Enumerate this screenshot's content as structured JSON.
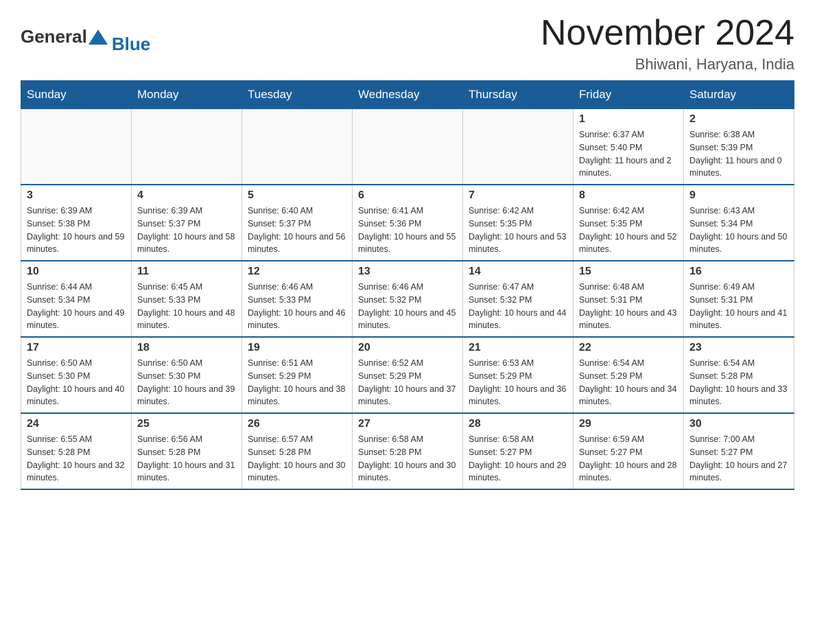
{
  "header": {
    "logo_text_general": "General",
    "logo_text_blue": "Blue",
    "calendar_title": "November 2024",
    "calendar_subtitle": "Bhiwani, Haryana, India"
  },
  "weekdays": [
    "Sunday",
    "Monday",
    "Tuesday",
    "Wednesday",
    "Thursday",
    "Friday",
    "Saturday"
  ],
  "weeks": [
    [
      {
        "day": "",
        "info": ""
      },
      {
        "day": "",
        "info": ""
      },
      {
        "day": "",
        "info": ""
      },
      {
        "day": "",
        "info": ""
      },
      {
        "day": "",
        "info": ""
      },
      {
        "day": "1",
        "info": "Sunrise: 6:37 AM\nSunset: 5:40 PM\nDaylight: 11 hours and 2 minutes."
      },
      {
        "day": "2",
        "info": "Sunrise: 6:38 AM\nSunset: 5:39 PM\nDaylight: 11 hours and 0 minutes."
      }
    ],
    [
      {
        "day": "3",
        "info": "Sunrise: 6:39 AM\nSunset: 5:38 PM\nDaylight: 10 hours and 59 minutes."
      },
      {
        "day": "4",
        "info": "Sunrise: 6:39 AM\nSunset: 5:37 PM\nDaylight: 10 hours and 58 minutes."
      },
      {
        "day": "5",
        "info": "Sunrise: 6:40 AM\nSunset: 5:37 PM\nDaylight: 10 hours and 56 minutes."
      },
      {
        "day": "6",
        "info": "Sunrise: 6:41 AM\nSunset: 5:36 PM\nDaylight: 10 hours and 55 minutes."
      },
      {
        "day": "7",
        "info": "Sunrise: 6:42 AM\nSunset: 5:35 PM\nDaylight: 10 hours and 53 minutes."
      },
      {
        "day": "8",
        "info": "Sunrise: 6:42 AM\nSunset: 5:35 PM\nDaylight: 10 hours and 52 minutes."
      },
      {
        "day": "9",
        "info": "Sunrise: 6:43 AM\nSunset: 5:34 PM\nDaylight: 10 hours and 50 minutes."
      }
    ],
    [
      {
        "day": "10",
        "info": "Sunrise: 6:44 AM\nSunset: 5:34 PM\nDaylight: 10 hours and 49 minutes."
      },
      {
        "day": "11",
        "info": "Sunrise: 6:45 AM\nSunset: 5:33 PM\nDaylight: 10 hours and 48 minutes."
      },
      {
        "day": "12",
        "info": "Sunrise: 6:46 AM\nSunset: 5:33 PM\nDaylight: 10 hours and 46 minutes."
      },
      {
        "day": "13",
        "info": "Sunrise: 6:46 AM\nSunset: 5:32 PM\nDaylight: 10 hours and 45 minutes."
      },
      {
        "day": "14",
        "info": "Sunrise: 6:47 AM\nSunset: 5:32 PM\nDaylight: 10 hours and 44 minutes."
      },
      {
        "day": "15",
        "info": "Sunrise: 6:48 AM\nSunset: 5:31 PM\nDaylight: 10 hours and 43 minutes."
      },
      {
        "day": "16",
        "info": "Sunrise: 6:49 AM\nSunset: 5:31 PM\nDaylight: 10 hours and 41 minutes."
      }
    ],
    [
      {
        "day": "17",
        "info": "Sunrise: 6:50 AM\nSunset: 5:30 PM\nDaylight: 10 hours and 40 minutes."
      },
      {
        "day": "18",
        "info": "Sunrise: 6:50 AM\nSunset: 5:30 PM\nDaylight: 10 hours and 39 minutes."
      },
      {
        "day": "19",
        "info": "Sunrise: 6:51 AM\nSunset: 5:29 PM\nDaylight: 10 hours and 38 minutes."
      },
      {
        "day": "20",
        "info": "Sunrise: 6:52 AM\nSunset: 5:29 PM\nDaylight: 10 hours and 37 minutes."
      },
      {
        "day": "21",
        "info": "Sunrise: 6:53 AM\nSunset: 5:29 PM\nDaylight: 10 hours and 36 minutes."
      },
      {
        "day": "22",
        "info": "Sunrise: 6:54 AM\nSunset: 5:29 PM\nDaylight: 10 hours and 34 minutes."
      },
      {
        "day": "23",
        "info": "Sunrise: 6:54 AM\nSunset: 5:28 PM\nDaylight: 10 hours and 33 minutes."
      }
    ],
    [
      {
        "day": "24",
        "info": "Sunrise: 6:55 AM\nSunset: 5:28 PM\nDaylight: 10 hours and 32 minutes."
      },
      {
        "day": "25",
        "info": "Sunrise: 6:56 AM\nSunset: 5:28 PM\nDaylight: 10 hours and 31 minutes."
      },
      {
        "day": "26",
        "info": "Sunrise: 6:57 AM\nSunset: 5:28 PM\nDaylight: 10 hours and 30 minutes."
      },
      {
        "day": "27",
        "info": "Sunrise: 6:58 AM\nSunset: 5:28 PM\nDaylight: 10 hours and 30 minutes."
      },
      {
        "day": "28",
        "info": "Sunrise: 6:58 AM\nSunset: 5:27 PM\nDaylight: 10 hours and 29 minutes."
      },
      {
        "day": "29",
        "info": "Sunrise: 6:59 AM\nSunset: 5:27 PM\nDaylight: 10 hours and 28 minutes."
      },
      {
        "day": "30",
        "info": "Sunrise: 7:00 AM\nSunset: 5:27 PM\nDaylight: 10 hours and 27 minutes."
      }
    ]
  ]
}
